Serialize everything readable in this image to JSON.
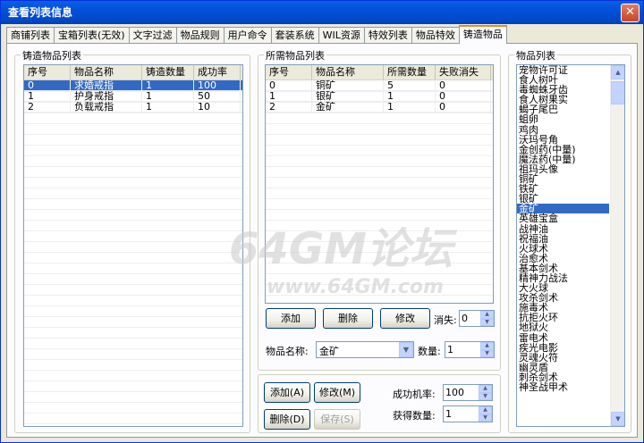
{
  "window": {
    "title": "查看列表信息",
    "close_glyph": "✕"
  },
  "tabs": [
    {
      "label": "商铺列表"
    },
    {
      "label": "宝箱列表(无效)"
    },
    {
      "label": "文字过滤"
    },
    {
      "label": "物品规则"
    },
    {
      "label": "用户命令"
    },
    {
      "label": "套装系统"
    },
    {
      "label": "WIL资源"
    },
    {
      "label": "特效列表"
    },
    {
      "label": "物品特效"
    },
    {
      "label": "铸造物品"
    }
  ],
  "forge_list": {
    "title": "铸造物品列表",
    "columns": [
      "序号",
      "物品名称",
      "铸造数量",
      "成功率"
    ],
    "rows": [
      [
        "0",
        "求婚戒指",
        "1",
        "100"
      ],
      [
        "1",
        "护身戒指",
        "1",
        "50"
      ],
      [
        "2",
        "负载戒指",
        "1",
        "10"
      ]
    ]
  },
  "required_list": {
    "title": "所需物品列表",
    "columns": [
      "序号",
      "物品名称",
      "所需数量",
      "失败消失"
    ],
    "rows": [
      [
        "0",
        "铜矿",
        "5",
        "0"
      ],
      [
        "1",
        "银矿",
        "1",
        "0"
      ],
      [
        "2",
        "金矿",
        "1",
        "0"
      ]
    ],
    "add_label": "添加",
    "delete_label": "删除",
    "modify_label": "修改",
    "vanish_label": "消失:",
    "vanish_value": "0",
    "item_name_label": "物品名称:",
    "item_name_value": "金矿",
    "qty_label": "数量:",
    "qty_value": "1"
  },
  "bottom": {
    "add_label": "添加(A)",
    "modify_label": "修改(M)",
    "delete_label": "删除(D)",
    "save_label": "保存(S)",
    "success_rate_label": "成功机率:",
    "success_rate_value": "100",
    "obtain_qty_label": "获得数量:",
    "obtain_qty_value": "1"
  },
  "item_list": {
    "title": "物品列表",
    "items": [
      "宠物许可证",
      "食人树叶",
      "毒蜘蛛牙齿",
      "食人树果实",
      "蝎子尾巴",
      "蛆卵",
      "鸡肉",
      "沃玛号角",
      "金创药(中量)",
      "魔法药(中量)",
      "祖玛头像",
      "铜矿",
      "铁矿",
      "银矿",
      "金矿",
      "英雄宝盒",
      "战神油",
      "祝福油",
      "火球术",
      "治愈术",
      "基本剑术",
      "精神力战法",
      "大火球",
      "攻杀剑术",
      "施毒术",
      "抗拒火环",
      "地狱火",
      "雷电术",
      "疾光电影",
      "灵魂火符",
      "幽灵盾",
      "刺杀剑术",
      "神圣战甲术"
    ],
    "selected": "金矿"
  },
  "watermark": {
    "line1": "64GM论坛",
    "line2": "www.64GM.com"
  }
}
